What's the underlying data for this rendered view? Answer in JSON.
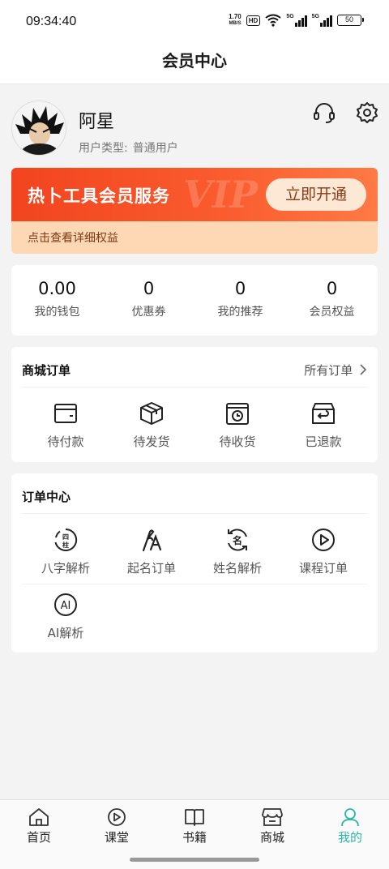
{
  "status_bar": {
    "time": "09:34:40",
    "net_speed_value": "1.70",
    "net_speed_unit": "MB/S",
    "hd_label": "HD",
    "signal1_label": "5G",
    "signal2_label": "5G",
    "battery": "50"
  },
  "header": {
    "title": "会员中心"
  },
  "profile": {
    "name": "阿星",
    "type_label": "用户类型:",
    "type_value": "普通用户",
    "support_icon": "headset-icon",
    "settings_icon": "gear-icon"
  },
  "vip": {
    "title": "热卜工具会员服务",
    "watermark": "VIP",
    "button": "立即开通",
    "subtitle": "点击查看详细权益"
  },
  "stats": [
    {
      "value": "0.00",
      "label": "我的钱包"
    },
    {
      "value": "0",
      "label": "优惠券"
    },
    {
      "value": "0",
      "label": "我的推荐"
    },
    {
      "value": "0",
      "label": "会员权益"
    }
  ],
  "shop_orders": {
    "title": "商城订单",
    "more": "所有订单",
    "items": [
      {
        "label": "待付款",
        "icon": "wallet-icon"
      },
      {
        "label": "待发货",
        "icon": "box-icon"
      },
      {
        "label": "待收货",
        "icon": "clock-box-icon"
      },
      {
        "label": "已退款",
        "icon": "return-box-icon"
      }
    ]
  },
  "order_center": {
    "title": "订单中心",
    "items": [
      {
        "label": "八字解析",
        "icon": "bazi-icon",
        "glyph_top": "四",
        "glyph_bottom": "柱"
      },
      {
        "label": "起名订单",
        "icon": "naming-icon"
      },
      {
        "label": "姓名解析",
        "icon": "name-analysis-icon",
        "glyph": "名"
      },
      {
        "label": "课程订单",
        "icon": "play-circle-icon"
      },
      {
        "label": "AI解析",
        "icon": "ai-icon",
        "glyph": "AI"
      }
    ]
  },
  "tabbar": [
    {
      "label": "首页",
      "icon": "home-icon",
      "active": false
    },
    {
      "label": "课堂",
      "icon": "play-circle-icon",
      "active": false
    },
    {
      "label": "书籍",
      "icon": "book-icon",
      "active": false
    },
    {
      "label": "商城",
      "icon": "store-icon",
      "active": false
    },
    {
      "label": "我的",
      "icon": "user-icon",
      "active": true
    }
  ],
  "colors": {
    "accent": "#2bb7a6",
    "vip_red": "#f2441f",
    "vip_light": "#fed7b5"
  }
}
